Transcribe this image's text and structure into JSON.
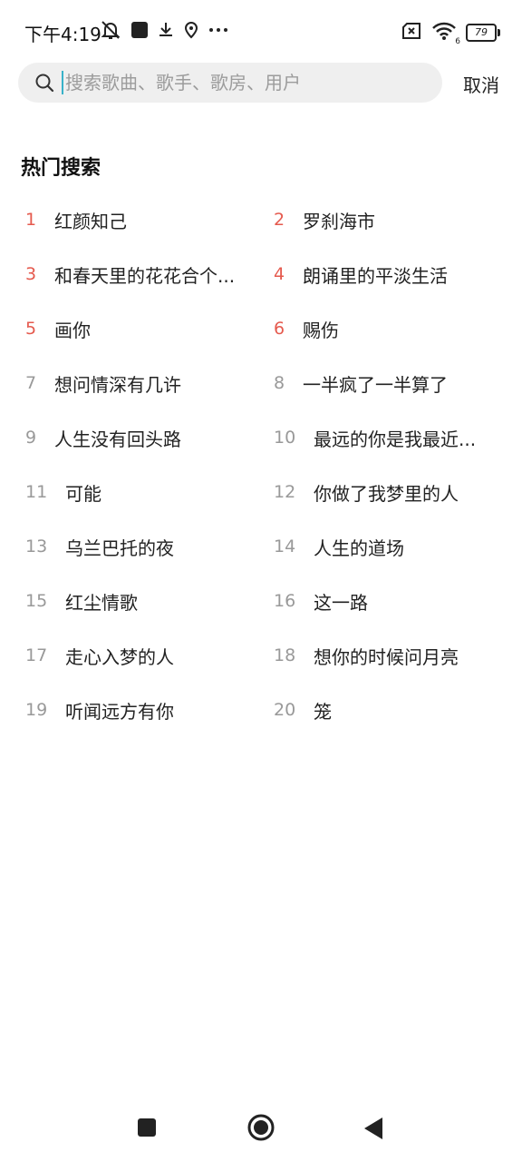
{
  "status": {
    "time": "下午4:19",
    "battery": "79",
    "icons_left": [
      "mute-bell-icon",
      "square-app-icon",
      "download-icon",
      "location-icon",
      "more-dots-icon"
    ],
    "icons_right": [
      "no-sim-icon",
      "wifi-icon",
      "battery-icon"
    ],
    "wifi_badge": "6"
  },
  "search": {
    "placeholder": "搜索歌曲、歌手、歌房、用户",
    "value": "",
    "cancel_label": "取消",
    "cursor_color": "#38b2c9"
  },
  "hot_search": {
    "title": "热门搜索",
    "hot_rank_color": "#e55a4e",
    "items": [
      {
        "rank": "1",
        "title": "红颜知己"
      },
      {
        "rank": "2",
        "title": "罗刹海市"
      },
      {
        "rank": "3",
        "title": "和春天里的花花合个..."
      },
      {
        "rank": "4",
        "title": "朗诵里的平淡生活"
      },
      {
        "rank": "5",
        "title": "画你"
      },
      {
        "rank": "6",
        "title": "赐伤"
      },
      {
        "rank": "7",
        "title": "想问情深有几许"
      },
      {
        "rank": "8",
        "title": "一半疯了一半算了"
      },
      {
        "rank": "9",
        "title": "人生没有回头路"
      },
      {
        "rank": "10",
        "title": "最远的你是我最近..."
      },
      {
        "rank": "11",
        "title": "可能"
      },
      {
        "rank": "12",
        "title": "你做了我梦里的人"
      },
      {
        "rank": "13",
        "title": "乌兰巴托的夜"
      },
      {
        "rank": "14",
        "title": "人生的道场"
      },
      {
        "rank": "15",
        "title": "红尘情歌"
      },
      {
        "rank": "16",
        "title": "这一路"
      },
      {
        "rank": "17",
        "title": "走心入梦的人"
      },
      {
        "rank": "18",
        "title": "想你的时候问月亮"
      },
      {
        "rank": "19",
        "title": "听闻远方有你"
      },
      {
        "rank": "20",
        "title": "笼"
      }
    ]
  },
  "nav": {
    "buttons": [
      "recents-square-icon",
      "home-circle-icon",
      "back-triangle-icon"
    ]
  }
}
